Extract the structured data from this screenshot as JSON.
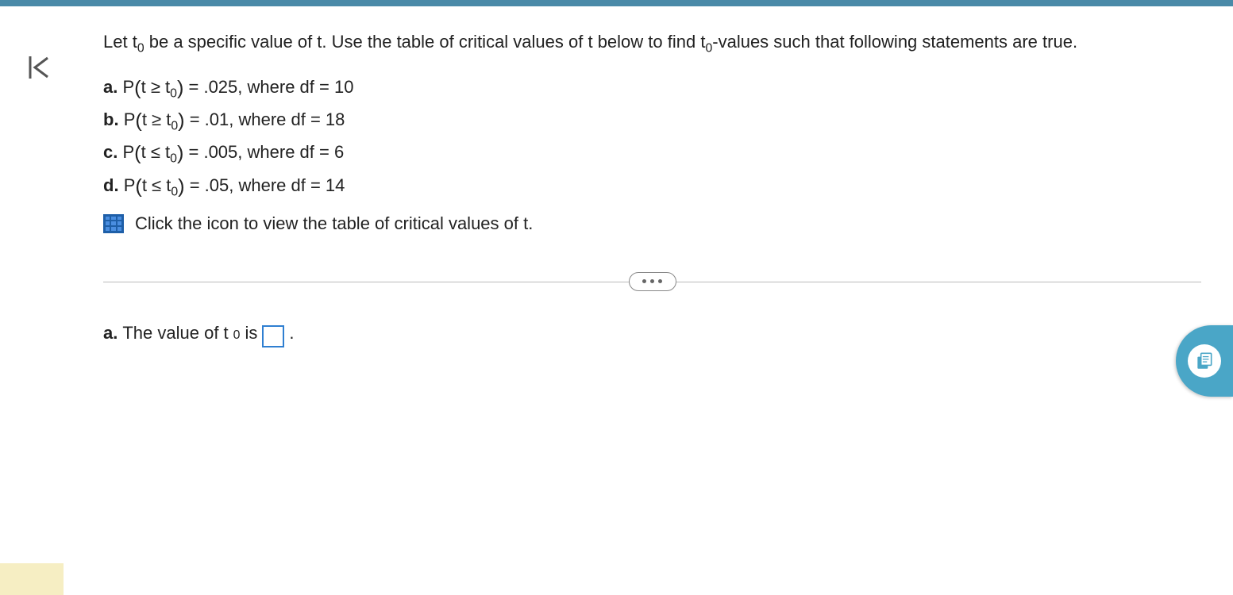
{
  "intro": {
    "part1": "Let t",
    "sub1": "0",
    "part2": " be a specific value of t. Use the table of critical values of t below to find t",
    "sub2": "0",
    "part3": "-values such that following statements are true."
  },
  "items": {
    "a": {
      "label": "a.",
      "P": "P",
      "ineq": "t ≥ t",
      "sub": "0",
      "tail": " = .025, where df = 10"
    },
    "b": {
      "label": "b.",
      "P": "P",
      "ineq": "t ≥ t",
      "sub": "0",
      "tail": " = .01, where df = 18"
    },
    "c": {
      "label": "c.",
      "P": "P",
      "ineq": "t ≤ t",
      "sub": "0",
      "tail": " = .005, where df = 6"
    },
    "d": {
      "label": "d.",
      "P": "P",
      "ineq": "t ≤ t",
      "sub": "0",
      "tail": " = .05, where df = 14"
    }
  },
  "table_link": "Click the icon to view the table of critical values of t.",
  "answer": {
    "label": "a.",
    "text1": " The value of t",
    "sub": "0",
    "text2": " is ",
    "value": "",
    "period": "."
  }
}
